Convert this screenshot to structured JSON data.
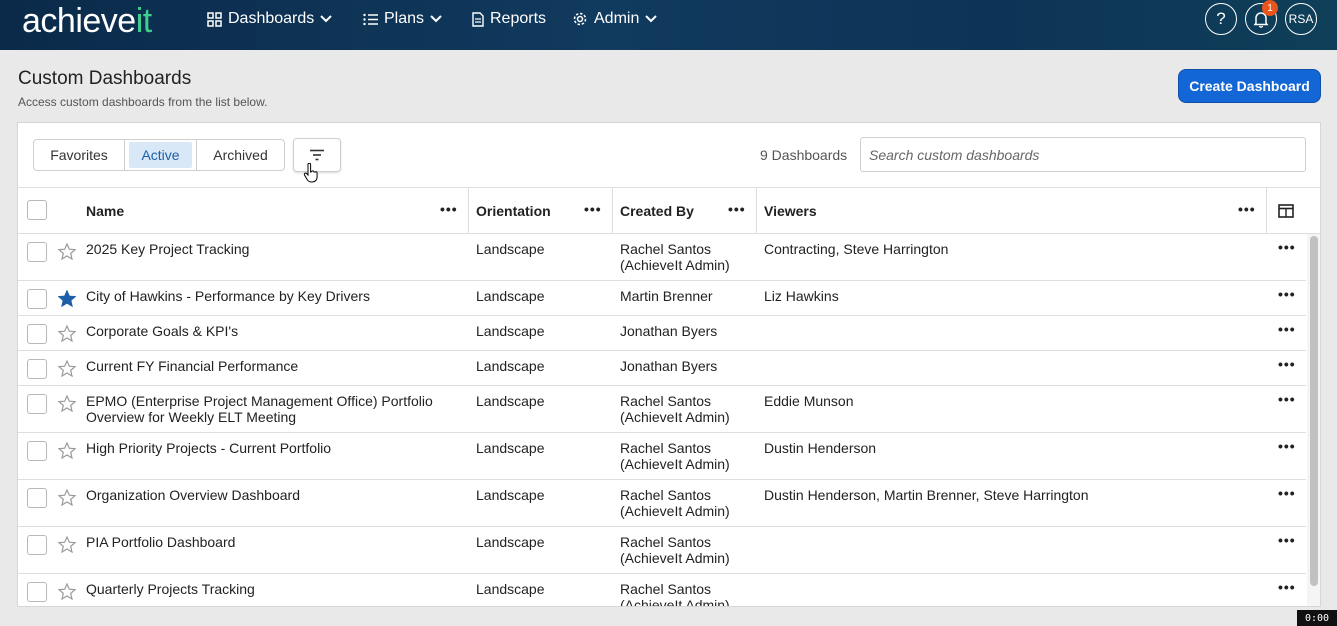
{
  "nav": {
    "logo_main": "achieve",
    "logo_accent": "it",
    "dashboards": "Dashboards",
    "plans": "Plans",
    "reports": "Reports",
    "admin": "Admin",
    "help_label": "?",
    "notification_count": "1",
    "avatar_initials": "RSA"
  },
  "header": {
    "title": "Custom Dashboards",
    "subtitle": "Access custom dashboards from the list below.",
    "create_button": "Create Dashboard"
  },
  "toolbar": {
    "tabs": [
      "Favorites",
      "Active",
      "Archived"
    ],
    "active_tab": "Active",
    "count_label": "9 Dashboards",
    "search_placeholder": "Search custom dashboards"
  },
  "table": {
    "columns": [
      "Name",
      "Orientation",
      "Created By",
      "Viewers"
    ],
    "rows": [
      {
        "name": "2025 Key Project Tracking",
        "orientation": "Landscape",
        "created_by": "Rachel Santos (AchieveIt Admin)",
        "viewers": "Contracting, Steve Harrington",
        "favorite": false
      },
      {
        "name": "City of Hawkins - Performance by Key Drivers",
        "orientation": "Landscape",
        "created_by": "Martin Brenner",
        "viewers": "Liz Hawkins",
        "favorite": true
      },
      {
        "name": "Corporate Goals & KPI's",
        "orientation": "Landscape",
        "created_by": "Jonathan Byers",
        "viewers": "",
        "favorite": false
      },
      {
        "name": "Current FY Financial Performance",
        "orientation": "Landscape",
        "created_by": "Jonathan Byers",
        "viewers": "",
        "favorite": false
      },
      {
        "name": "EPMO (Enterprise Project Management Office) Portfolio Overview for Weekly ELT Meeting",
        "orientation": "Landscape",
        "created_by": "Rachel Santos (AchieveIt Admin)",
        "viewers": "Eddie Munson",
        "favorite": false
      },
      {
        "name": "High Priority Projects - Current Portfolio",
        "orientation": "Landscape",
        "created_by": "Rachel Santos (AchieveIt Admin)",
        "viewers": "Dustin Henderson",
        "favorite": false
      },
      {
        "name": "Organization Overview Dashboard",
        "orientation": "Landscape",
        "created_by": "Rachel Santos (AchieveIt Admin)",
        "viewers": "Dustin Henderson, Martin Brenner, Steve Harrington",
        "favorite": false
      },
      {
        "name": "PIA Portfolio Dashboard",
        "orientation": "Landscape",
        "created_by": "Rachel Santos (AchieveIt Admin)",
        "viewers": "",
        "favorite": false
      },
      {
        "name": "Quarterly Projects Tracking",
        "orientation": "Landscape",
        "created_by": "Rachel Santos (AchieveIt Admin)",
        "viewers": "",
        "favorite": false
      }
    ]
  },
  "colors": {
    "primary": "#1366d6",
    "accent_green": "#3ecf8e",
    "star_filled": "#1d5fa8",
    "badge": "#e8541a"
  },
  "icons": [
    "dashboard-grid-icon",
    "list-icon",
    "document-icon",
    "gear-icon",
    "chevron-down-icon",
    "help-icon",
    "bell-icon",
    "filter-icon",
    "star-icon",
    "more-icon",
    "columns-icon",
    "hand-cursor-icon"
  ]
}
